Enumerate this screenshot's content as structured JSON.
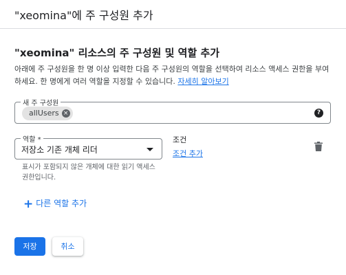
{
  "dialog": {
    "title": "\"xeomina\"에 주 구성원 추가"
  },
  "section": {
    "title": "\"xeomina\" 리소스의 주 구성원 및 역할 추가",
    "description": "아래에 주 구성원을 한 명 이상 입력한 다음 주 구성원의 역할을 선택하여 리소스 액세스 권한을 부여하세요. 한 명에게 여러 역할을 지정할 수 있습니다.",
    "learn_more": "자세히 알아보기"
  },
  "members_field": {
    "label": "새 주 구성원",
    "chip": "allUsers",
    "chip_remove_glyph": "×",
    "help_glyph": "?"
  },
  "role": {
    "label": "역할 *",
    "value": "저장소 기존 개체 리더",
    "hint": "표시가 포함되지 않은 개체에 대한 읽기 액세스 권한입니다."
  },
  "condition": {
    "title": "조건",
    "add_link": "조건 추가"
  },
  "add_role": {
    "glyph": "+",
    "label": "다른 역할 추가"
  },
  "actions": {
    "save": "저장",
    "cancel": "취소"
  },
  "colors": {
    "accent": "#1a73e8",
    "chip_bg": "#e3e3e3",
    "divider": "#dadce0"
  }
}
